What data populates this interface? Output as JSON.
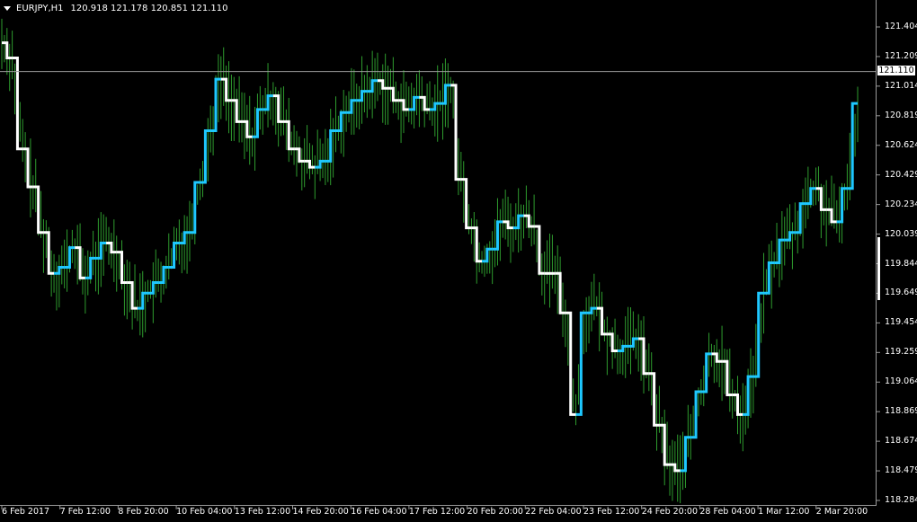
{
  "header": {
    "symbol": "EURJPY,H1",
    "ohlc": "120.918 121.178 120.851 121.110"
  },
  "colors": {
    "background": "#000000",
    "candles": "#2e9c2e",
    "line_up": "#1ec8ff",
    "line_down": "#ffffff",
    "grid": "#9a9a9a"
  },
  "price_axis": {
    "labels": [
      "121.404",
      "121.209",
      "121.014",
      "120.819",
      "120.624",
      "120.429",
      "120.234",
      "120.039",
      "119.844",
      "119.649",
      "119.454",
      "119.259",
      "119.064",
      "118.869",
      "118.674",
      "118.479",
      "118.284"
    ],
    "current_price": "121.110"
  },
  "time_axis": {
    "labels": [
      "6 Feb 2017",
      "7 Feb 12:00",
      "8 Feb 20:00",
      "10 Feb 04:00",
      "13 Feb 12:00",
      "14 Feb 20:00",
      "16 Feb 04:00",
      "17 Feb 12:00",
      "20 Feb 20:00",
      "22 Feb 04:00",
      "23 Feb 12:00",
      "24 Feb 20:00",
      "28 Feb 04:00",
      "1 Mar 12:00",
      "2 Mar 20:00"
    ]
  },
  "chart_data": {
    "type": "line",
    "symbol": "EURJPY",
    "timeframe": "H1",
    "ylim": [
      118.25,
      121.52
    ],
    "current_price": 121.11,
    "series": [
      {
        "values": [
          121.3,
          121.2,
          120.6,
          120.35,
          120.05,
          119.78,
          119.82,
          119.95,
          119.75,
          119.88,
          119.98,
          119.92,
          119.72,
          119.55,
          119.65,
          119.72,
          119.82,
          119.98,
          120.05,
          120.38,
          120.72,
          121.06,
          120.92,
          120.78,
          120.68,
          120.86,
          120.95,
          120.78,
          120.6,
          120.52,
          120.48,
          120.52,
          120.72,
          120.84,
          120.92,
          120.98,
          121.05,
          121.0,
          120.92,
          120.86,
          120.94,
          120.86,
          120.9,
          121.02,
          120.4,
          120.08,
          119.86,
          119.94,
          120.12,
          120.08,
          120.16,
          120.09,
          119.78,
          119.78,
          119.52,
          118.85,
          119.52,
          119.55,
          119.38,
          119.27,
          119.3,
          119.35,
          119.12,
          118.78,
          118.52,
          118.48,
          118.7,
          119.0,
          119.25,
          119.2,
          118.98,
          118.85,
          119.1,
          119.65,
          119.85,
          120.0,
          120.05,
          120.24,
          120.34,
          120.2,
          120.12,
          120.34,
          120.9
        ]
      }
    ]
  }
}
